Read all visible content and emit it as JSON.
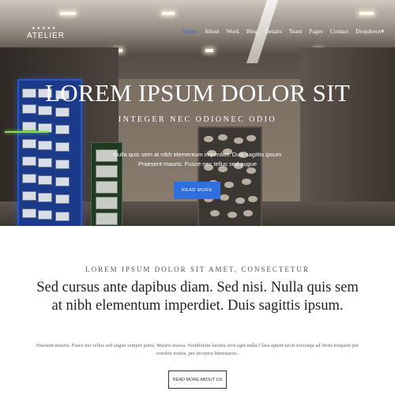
{
  "header": {
    "logo_text": "ATELIER",
    "logo_stars": "★★★★★",
    "nav": [
      {
        "label": "Home",
        "active": true
      },
      {
        "label": "About"
      },
      {
        "label": "Work"
      },
      {
        "label": "Blog"
      },
      {
        "label": "Details"
      },
      {
        "label": "Team"
      },
      {
        "label": "Pages"
      },
      {
        "label": "Contact"
      },
      {
        "label": "Dropdown"
      }
    ]
  },
  "hero": {
    "title": "LOREM IPSUM DOLOR SIT",
    "subtitle": "INTEGER NEC ODIONEC ODIO",
    "text": "Nulla quis sem at nibh elementum imperdiet. Duis sagittis ipsum Praesent mauris. Fusce nec tellus sed augue",
    "button_label": "READ MORE"
  },
  "about": {
    "kicker": "LOREM IPSUM DOLOR SIT AMET, CONSECTETUR",
    "heading": "Sed cursus ante dapibus diam. Sed nisi. Nulla quis sem at nibh elementum imperdiet. Duis sagittis ipsum.",
    "paragraph": "Praesent mauris. Fusce nec tellus sed augue semper porta. Mauris massa. Vestibulum lacinia arcu eget nulla.Class aptent taciti sociosqu ad litora torquent per conubia nostra, per inceptos himenaeos..",
    "button_label": "READ MORE ABOUT US"
  },
  "colors": {
    "accent": "#2f6fe0",
    "text_dark": "#222222",
    "text_muted": "#666666"
  }
}
